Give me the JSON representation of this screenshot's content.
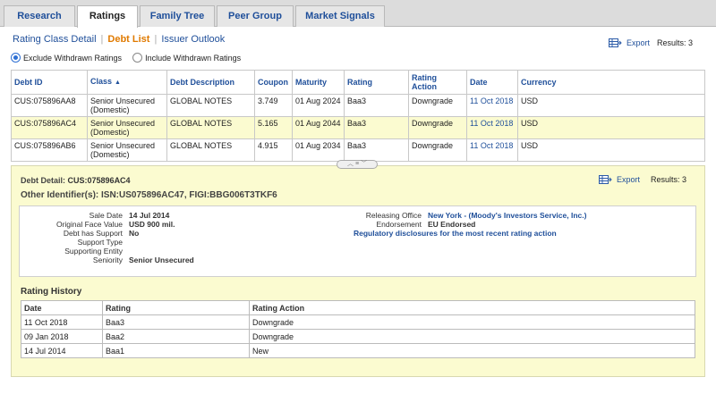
{
  "tabs": [
    {
      "label": "Research"
    },
    {
      "label": "Ratings"
    },
    {
      "label": "Family Tree"
    },
    {
      "label": "Peer Group"
    },
    {
      "label": "Market Signals"
    }
  ],
  "active_tab": "Ratings",
  "subtabs": {
    "rating_class_detail": "Rating Class Detail",
    "debt_list": "Debt List",
    "issuer_outlook": "Issuer Outlook"
  },
  "toolbar": {
    "export_label": "Export",
    "results": "Results: 3"
  },
  "filters": {
    "exclude": "Exclude Withdrawn Ratings",
    "include": "Include Withdrawn Ratings"
  },
  "debt_table": {
    "headers": {
      "debt_id": "Debt ID",
      "class": "Class",
      "description": "Debt Description",
      "coupon": "Coupon",
      "maturity": "Maturity",
      "rating": "Rating",
      "rating_action": "Rating Action",
      "date": "Date",
      "currency": "Currency"
    },
    "rows": [
      {
        "debt_id": "CUS:075896AA8",
        "class": "Senior Unsecured (Domestic)",
        "description": "GLOBAL NOTES",
        "coupon": "3.749",
        "maturity": "01 Aug 2024",
        "rating": "Baa3",
        "rating_action": "Downgrade",
        "date": "11 Oct 2018",
        "currency": "USD"
      },
      {
        "debt_id": "CUS:075896AC4",
        "class": "Senior Unsecured (Domestic)",
        "description": "GLOBAL NOTES",
        "coupon": "5.165",
        "maturity": "01 Aug 2044",
        "rating": "Baa3",
        "rating_action": "Downgrade",
        "date": "11 Oct 2018",
        "currency": "USD"
      },
      {
        "debt_id": "CUS:075896AB6",
        "class": "Senior Unsecured (Domestic)",
        "description": "GLOBAL NOTES",
        "coupon": "4.915",
        "maturity": "01 Aug 2034",
        "rating": "Baa3",
        "rating_action": "Downgrade",
        "date": "11 Oct 2018",
        "currency": "USD"
      }
    ]
  },
  "detail": {
    "title_label": "Debt Detail:",
    "title_value": "CUS:075896AC4",
    "other_ids": "Other Identifier(s): ISN:US075896AC47, FIGI:BBG006T3TKF6",
    "export_label": "Export",
    "results": "Results: 3",
    "fields": {
      "sale_date_label": "Sale Date",
      "sale_date": "14 Jul 2014",
      "face_value_label": "Original Face Value",
      "face_value": "USD 900 mil.",
      "has_support_label": "Debt has Support",
      "has_support": "No",
      "support_type_label": "Support Type",
      "supporting_entity_label": "Supporting Entity",
      "seniority_label": "Seniority",
      "seniority": "Senior Unsecured",
      "releasing_office_label": "Releasing Office",
      "releasing_office": "New York - (Moody's Investors Service, Inc.)",
      "endorsement_label": "Endorsement",
      "endorsement": "EU Endorsed",
      "regulatory_link": "Regulatory disclosures for the most recent rating action"
    },
    "history": {
      "title": "Rating History",
      "headers": {
        "date": "Date",
        "rating": "Rating",
        "action": "Rating Action"
      },
      "rows": [
        {
          "date": "11 Oct 2018",
          "rating": "Baa3",
          "action": "Downgrade"
        },
        {
          "date": "09 Jan 2018",
          "rating": "Baa2",
          "action": "Downgrade"
        },
        {
          "date": "14 Jul 2014",
          "rating": "Baa1",
          "action": "New"
        }
      ]
    }
  },
  "colors": {
    "link": "#1f4f9a",
    "active_subtab": "#e07a00",
    "selected_row": "#fbfbd0"
  }
}
